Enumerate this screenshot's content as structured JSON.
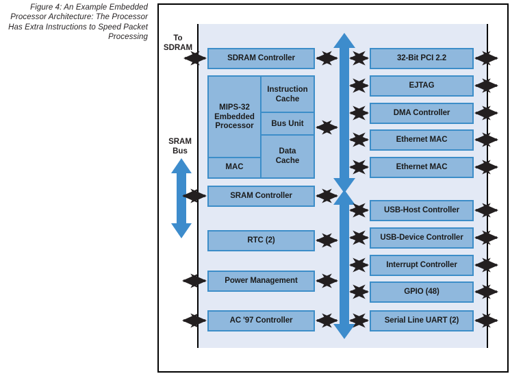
{
  "caption": "Figure 4: An Example Embedded Processor Architecture: The Processor Has Extra Instructions to Speed Packet Processing",
  "colors": {
    "block_fill": "#8fb8dd",
    "block_border": "#3c8dc8",
    "panel_background": "#e3e9f5",
    "bus_arrow": "#3d8ccc",
    "frame_border": "#000000",
    "connector_arrow": "#231f20",
    "text": "#1b1b1b"
  },
  "edge_labels": {
    "to_sdram": "To\nSDRAM",
    "to_sdram_line1": "To",
    "to_sdram_line2": "SDRAM",
    "sram_bus_line1": "SRAM",
    "sram_bus_line2": "Bus"
  },
  "processor": {
    "name_line1": "MIPS-32",
    "name_line2": "Embedded",
    "name_line3": "Processor",
    "mac": "MAC",
    "instruction_cache_line1": "Instruction",
    "instruction_cache_line2": "Cache",
    "bus_unit": "Bus Unit",
    "data_cache_line1": "Data",
    "data_cache_line2": "Cache"
  },
  "left_column": [
    {
      "label": "SDRAM Controller"
    },
    {
      "label": "SRAM Controller"
    },
    {
      "label": "RTC (2)"
    },
    {
      "label": "Power Management"
    },
    {
      "label": "AC '97 Controller"
    }
  ],
  "right_column": [
    {
      "label": "32-Bit PCI 2.2"
    },
    {
      "label": "EJTAG"
    },
    {
      "label": "DMA Controller"
    },
    {
      "label": "Ethernet MAC"
    },
    {
      "label": "Ethernet MAC"
    },
    {
      "label": "USB-Host Controller"
    },
    {
      "label": "USB-Device Controller"
    },
    {
      "label": "Interrupt Controller"
    },
    {
      "label": "GPIO (48)"
    },
    {
      "label": "Serial Line UART (2)"
    }
  ],
  "buses": {
    "internal_bus_upper": "internal-bus-upper",
    "internal_bus_lower": "internal-bus-lower",
    "sram_bus": "sram-bus"
  }
}
